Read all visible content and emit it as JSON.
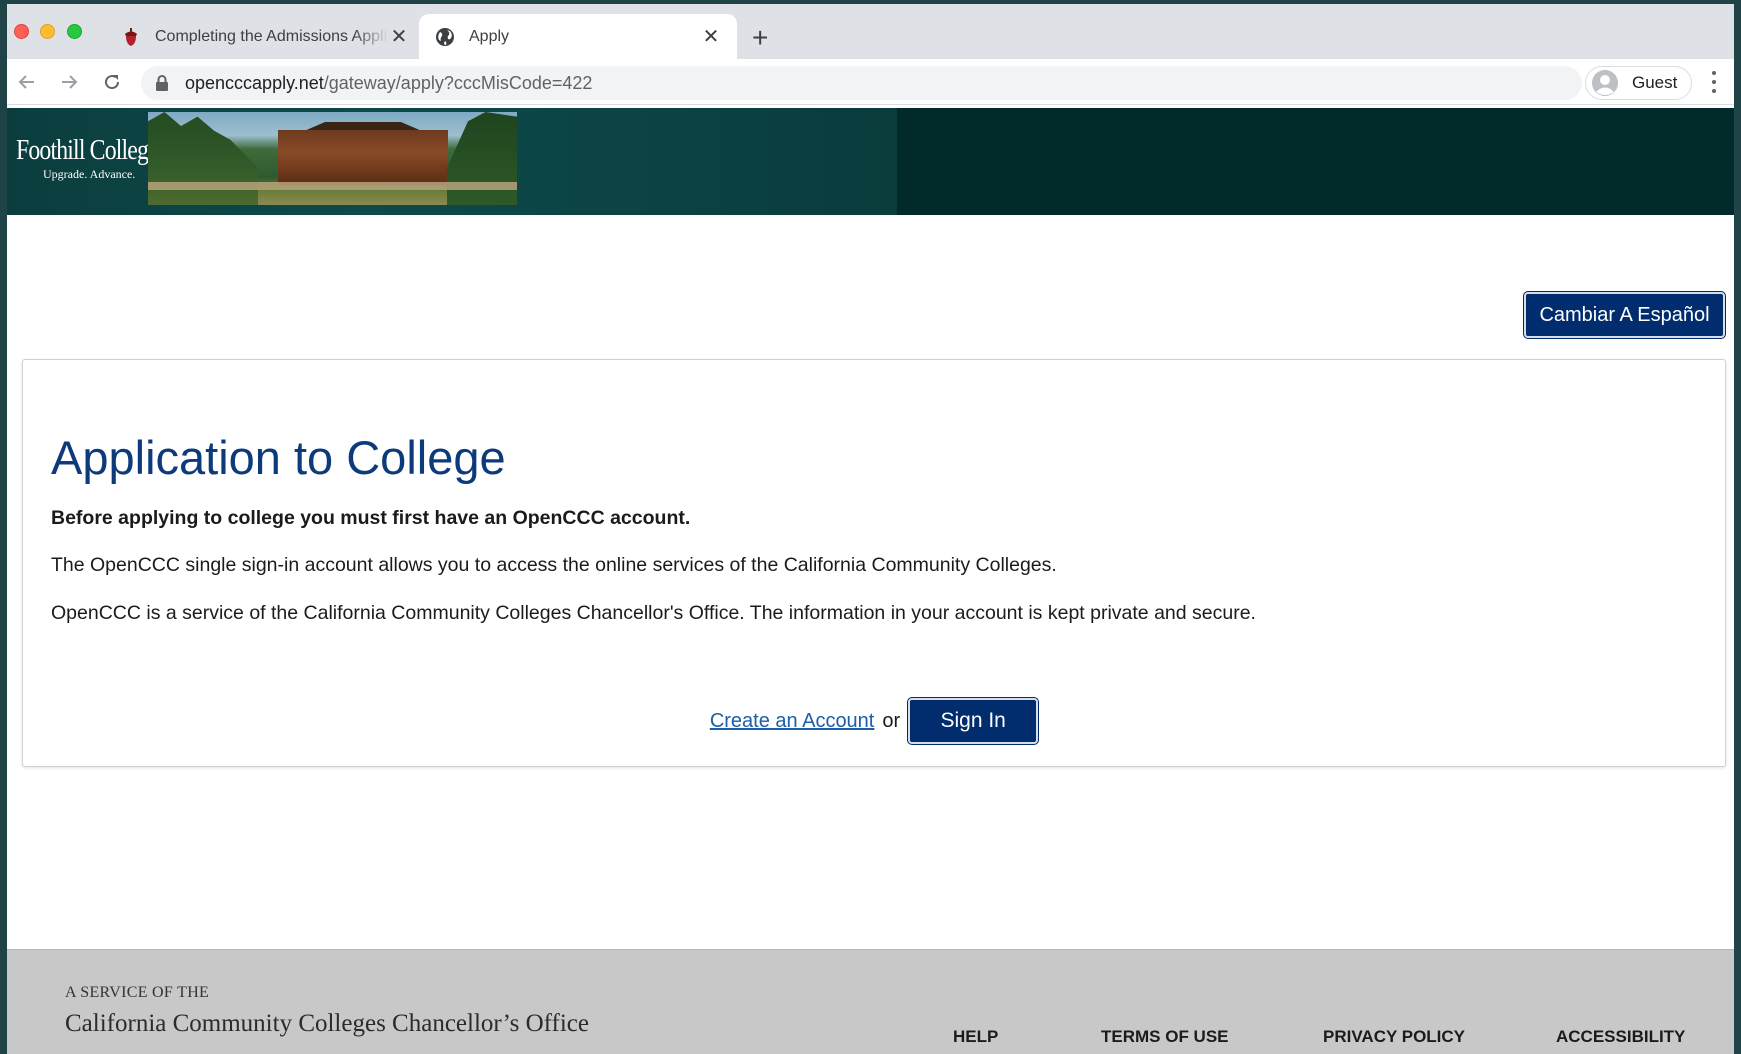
{
  "browser": {
    "tabs": [
      {
        "title": "Completing the Admissions Application",
        "favicon": "acorn-icon",
        "active": false
      },
      {
        "title": "Apply",
        "favicon": "globe-icon",
        "active": true
      }
    ],
    "new_tab": "+",
    "close_glyph": "✕",
    "url_host": "opencccapply.net",
    "url_path": "/gateway/apply?cccMisCode=422",
    "profile_label": "Guest"
  },
  "banner": {
    "logo_name": "Foothill College",
    "logo_tagline": "Upgrade. Advance."
  },
  "page": {
    "language_button": "Cambiar A Español",
    "heading": "Application to College",
    "intro_bold": "Before applying to college you must first have an OpenCCC account.",
    "paragraph_1": "The OpenCCC single sign-in account allows you to access the online services of the California Community Colleges.",
    "paragraph_2": "OpenCCC is a service of the California Community Colleges Chancellor's Office. The information in your account is kept private and secure.",
    "create_account_link": "Create an Account",
    "or_text": "or",
    "sign_in_button": "Sign In"
  },
  "footer": {
    "service_label": "A SERVICE OF THE",
    "office_name": "California Community Colleges Chancellor’s Office",
    "links": [
      "HELP",
      "TERMS OF USE",
      "PRIVACY POLICY",
      "ACCESSIBILITY"
    ]
  },
  "colors": {
    "primary_button": "#012c6e",
    "heading": "#0d3a7a",
    "link": "#1a5fa8",
    "banner": "#022a2b",
    "footer": "#c8c8c8"
  }
}
